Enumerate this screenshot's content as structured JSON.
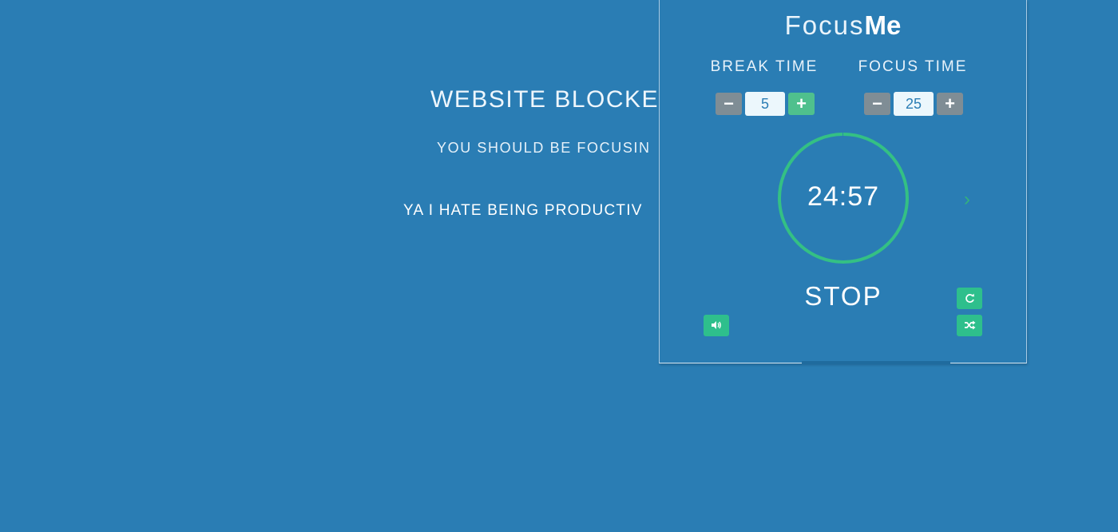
{
  "blocked_page": {
    "title": "WEBSITE BLOCKE",
    "subtitle": "YOU SHOULD BE FOCUSIN",
    "link": "YA I HATE BEING PRODUCTIV"
  },
  "popup": {
    "logo": {
      "light": "Focus",
      "bold": "Me"
    },
    "break_time": {
      "label": "BREAK TIME",
      "value": "5",
      "minus": "−",
      "plus": "+"
    },
    "focus_time": {
      "label": "FOCUS TIME",
      "value": "25",
      "minus": "−",
      "plus": "+"
    },
    "timer": {
      "display": "24:57",
      "progress": 0.998
    },
    "next_icon": "chevron-right-icon",
    "stop_label": "STOP",
    "icons": {
      "sound": "volume-icon",
      "reset": "refresh-icon",
      "shuffle": "shuffle-icon"
    },
    "colors": {
      "background": "#2a7db4",
      "accent": "#2ebf8c",
      "ring": "#34c084",
      "stepper_gray": "#7f8d95"
    }
  }
}
